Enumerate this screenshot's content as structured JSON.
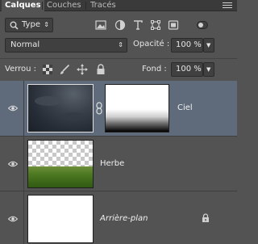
{
  "tabs": [
    {
      "label": "Calques",
      "active": true
    },
    {
      "label": "Couches",
      "active": false
    },
    {
      "label": "Tracés",
      "active": false
    }
  ],
  "filter": {
    "type_label": "Type"
  },
  "blend": {
    "mode": "Normal",
    "opacity_label": "Opacité :",
    "opacity_value": "100 %"
  },
  "lock": {
    "label": "Verrou :",
    "fill_label": "Fond :",
    "fill_value": "100 %"
  },
  "layers": [
    {
      "name": "Ciel",
      "selected": true,
      "has_mask": true,
      "italic": false,
      "locked": false
    },
    {
      "name": "Herbe",
      "selected": false,
      "has_mask": false,
      "italic": false,
      "locked": false
    },
    {
      "name": "Arrière-plan",
      "selected": false,
      "has_mask": false,
      "italic": true,
      "locked": true
    }
  ],
  "colors": {
    "panel": "#535353",
    "selected_row": "#5f6b7a",
    "tabbar": "#3a3a3a"
  }
}
